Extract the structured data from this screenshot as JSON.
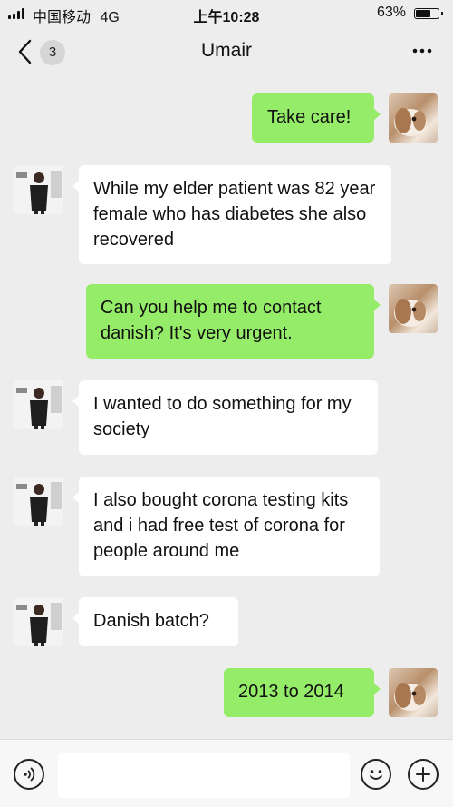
{
  "status_bar": {
    "carrier": "中国移动",
    "network": "4G",
    "time": "上午10:28",
    "battery": "63%",
    "battery_level": 0.63
  },
  "nav": {
    "title": "Umair",
    "unread_count": "3",
    "back_icon": "chevron-left-icon",
    "more_icon": "more-dots-icon"
  },
  "messages": [
    {
      "from": "me",
      "text": "Take care!"
    },
    {
      "from": "them",
      "text": "While my elder patient was 82 year female who has diabetes she also recovered"
    },
    {
      "from": "me",
      "text": "Can you help me to contact danish? It's very urgent."
    },
    {
      "from": "them",
      "text": "I wanted to do something for my society"
    },
    {
      "from": "them",
      "text": "I also bought corona testing kits and i had free test of corona for people around me"
    },
    {
      "from": "them",
      "text": "Danish batch?"
    },
    {
      "from": "me",
      "text": "2013 to 2014"
    }
  ],
  "input_bar": {
    "voice_icon": "voice-icon",
    "emoji_icon": "emoji-icon",
    "plus_icon": "plus-icon",
    "text_value": ""
  },
  "colors": {
    "background": "#ededed",
    "outgoing_bubble": "#95ec69",
    "incoming_bubble": "#ffffff"
  }
}
